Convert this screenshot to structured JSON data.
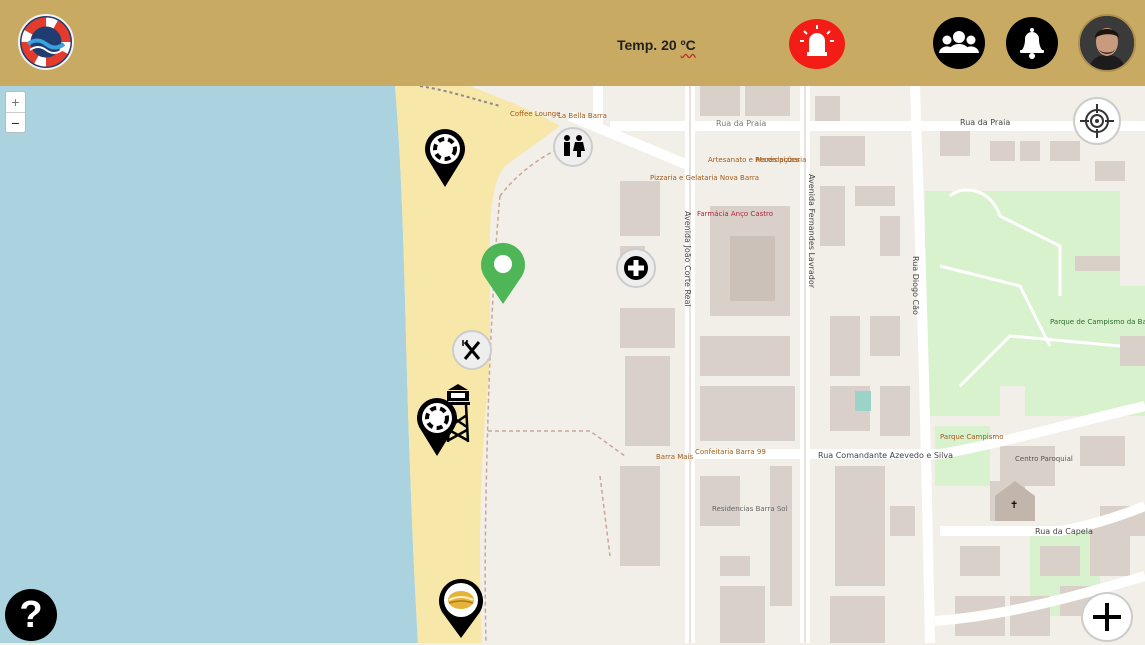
{
  "header": {
    "logo_icon": "lifebuoy-logo-icon",
    "temperature_label": "Temp. 20 ",
    "temperature_unit": "ºC",
    "alarm_icon": "siren-icon",
    "alarm_color": "#f21d16",
    "group_icon": "users-group-icon",
    "notifications_icon": "bell-icon",
    "avatar_icon": "user-avatar"
  },
  "map": {
    "zoom_in_label": "+",
    "zoom_out_label": "−",
    "locate_icon": "crosshair-icon",
    "help_label": "?",
    "add_label": "+",
    "colors": {
      "sea": "#aad3df",
      "beach": "#f7e7a9",
      "land": "#f2efe9",
      "park": "#d8f2ce",
      "building": "#d9d0c9",
      "bar": "#c9aa63"
    },
    "street_labels": [
      "Rua da Praia",
      "Avenida João Corte Real",
      "Avenida Fernandes Lavrador",
      "Rua Diogo Cão",
      "Rua Comandante Azevedo e Silva",
      "Rua da Capela",
      "Parque de Campismo da Barra",
      "Centro Paroquial",
      "Farmácia Anço Castro",
      "Artesanato e Recordações",
      "Pizzaria e Gelataria Nova Barra",
      "Coffee Lounge",
      "La Bella Barra",
      "Residencias Barra Sol",
      "Confeitaria Barra 99",
      "Barra Mais",
      "Parque Campismo",
      "Marés pizzaria"
    ],
    "markers": [
      {
        "name": "lifeguard-marker-north",
        "icon": "lifebuoy-icon"
      },
      {
        "name": "toilets-marker",
        "icon": "toilets-icon"
      },
      {
        "name": "current-location-marker",
        "icon": "green-pin-icon"
      },
      {
        "name": "first-aid-marker",
        "icon": "medical-cross-icon"
      },
      {
        "name": "restaurant-marker",
        "icon": "cutlery-icon"
      },
      {
        "name": "lifeguard-tower-marker",
        "icon": "watchtower-icon"
      },
      {
        "name": "lifeguard-marker-south",
        "icon": "lifebuoy-icon"
      },
      {
        "name": "food-marker",
        "icon": "sandwich-icon"
      }
    ]
  }
}
